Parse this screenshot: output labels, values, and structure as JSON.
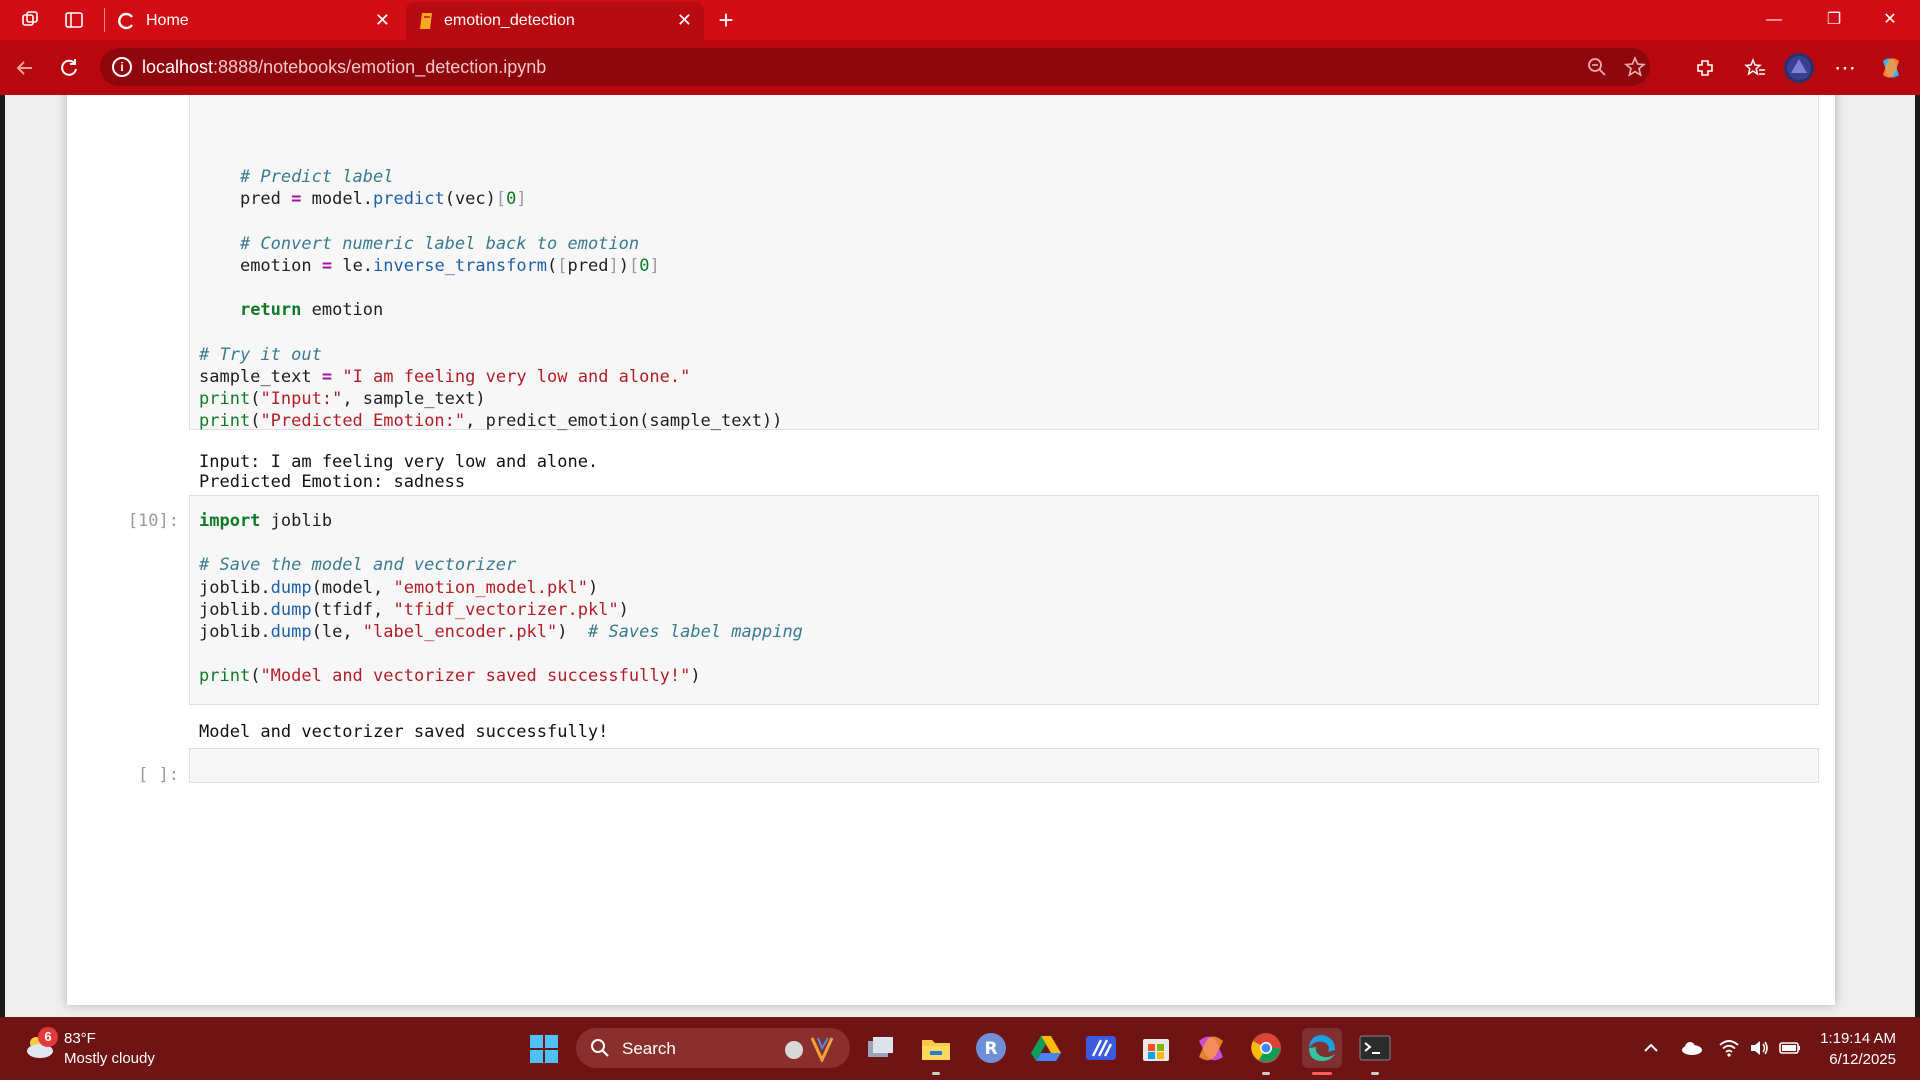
{
  "browser": {
    "tabs": [
      {
        "title": "Home",
        "close": "✕"
      },
      {
        "title": "emotion_detection",
        "close": "✕"
      }
    ],
    "new_tab": "+",
    "window_controls": {
      "minimize": "—",
      "restore": "❐",
      "close": "✕"
    },
    "address": {
      "host": "localhost",
      "rest": ":8888/notebooks/emotion_detection.ipynb"
    }
  },
  "notebook": {
    "prev_cell_lines": [
      {
        "indent": "    ",
        "tokens": [
          {
            "t": "# Predict label",
            "c": "cm"
          }
        ]
      },
      {
        "indent": "    ",
        "tokens": [
          {
            "t": "pred ",
            "c": ""
          },
          {
            "t": "=",
            "c": "op"
          },
          {
            "t": " model.",
            "c": ""
          },
          {
            "t": "predict",
            "c": "fn"
          },
          {
            "t": "(vec)",
            "c": ""
          },
          {
            "t": "[",
            "c": "br"
          },
          {
            "t": "0",
            "c": "num"
          },
          {
            "t": "]",
            "c": "br"
          }
        ]
      },
      {
        "indent": "",
        "tokens": []
      },
      {
        "indent": "    ",
        "tokens": [
          {
            "t": "# Convert numeric label back to emotion",
            "c": "cm"
          }
        ]
      },
      {
        "indent": "    ",
        "tokens": [
          {
            "t": "emotion ",
            "c": ""
          },
          {
            "t": "=",
            "c": "op"
          },
          {
            "t": " le.",
            "c": ""
          },
          {
            "t": "inverse_transform",
            "c": "fn"
          },
          {
            "t": "(",
            "c": ""
          },
          {
            "t": "[",
            "c": "br"
          },
          {
            "t": "pred",
            "c": ""
          },
          {
            "t": "]",
            "c": "br"
          },
          {
            "t": ")",
            "c": ""
          },
          {
            "t": "[",
            "c": "br"
          },
          {
            "t": "0",
            "c": "num"
          },
          {
            "t": "]",
            "c": "br"
          }
        ]
      },
      {
        "indent": "",
        "tokens": []
      },
      {
        "indent": "    ",
        "tokens": [
          {
            "t": "return",
            "c": "kw"
          },
          {
            "t": " emotion",
            "c": ""
          }
        ]
      },
      {
        "indent": "",
        "tokens": []
      },
      {
        "indent": "",
        "tokens": [
          {
            "t": "# Try it out",
            "c": "cm"
          }
        ]
      },
      {
        "indent": "",
        "tokens": [
          {
            "t": "sample_text ",
            "c": ""
          },
          {
            "t": "=",
            "c": "op"
          },
          {
            "t": " ",
            "c": ""
          },
          {
            "t": "\"I am feeling very low and alone.\"",
            "c": "st"
          }
        ]
      },
      {
        "indent": "",
        "tokens": [
          {
            "t": "print",
            "c": "nb"
          },
          {
            "t": "(",
            "c": ""
          },
          {
            "t": "\"Input:\"",
            "c": "st"
          },
          {
            "t": ", sample_text)",
            "c": ""
          }
        ]
      },
      {
        "indent": "",
        "tokens": [
          {
            "t": "print",
            "c": "nb"
          },
          {
            "t": "(",
            "c": ""
          },
          {
            "t": "\"Predicted Emotion:\"",
            "c": "st"
          },
          {
            "t": ", predict_emotion(sample_text))",
            "c": ""
          }
        ]
      }
    ],
    "prev_output": [
      "Input: I am feeling very low and alone.",
      "Predicted Emotion: sadness"
    ],
    "cell10_prompt": "[10]:",
    "cell10_lines": [
      {
        "indent": "",
        "tokens": [
          {
            "t": "import",
            "c": "kw"
          },
          {
            "t": " joblib",
            "c": ""
          }
        ]
      },
      {
        "indent": "",
        "tokens": []
      },
      {
        "indent": "",
        "tokens": [
          {
            "t": "# Save the model and vectorizer",
            "c": "cm"
          }
        ]
      },
      {
        "indent": "",
        "tokens": [
          {
            "t": "joblib.",
            "c": ""
          },
          {
            "t": "dump",
            "c": "fn"
          },
          {
            "t": "(model, ",
            "c": ""
          },
          {
            "t": "\"emotion_model.pkl\"",
            "c": "st"
          },
          {
            "t": ")",
            "c": ""
          }
        ]
      },
      {
        "indent": "",
        "tokens": [
          {
            "t": "joblib.",
            "c": ""
          },
          {
            "t": "dump",
            "c": "fn"
          },
          {
            "t": "(tfidf, ",
            "c": ""
          },
          {
            "t": "\"tfidf_vectorizer.pkl\"",
            "c": "st"
          },
          {
            "t": ")",
            "c": ""
          }
        ]
      },
      {
        "indent": "",
        "tokens": [
          {
            "t": "joblib.",
            "c": ""
          },
          {
            "t": "dump",
            "c": "fn"
          },
          {
            "t": "(le, ",
            "c": ""
          },
          {
            "t": "\"label_encoder.pkl\"",
            "c": "st"
          },
          {
            "t": ")  ",
            "c": ""
          },
          {
            "t": "# Saves label mapping",
            "c": "cm"
          }
        ]
      },
      {
        "indent": "",
        "tokens": []
      },
      {
        "indent": "",
        "tokens": [
          {
            "t": "print",
            "c": "nb"
          },
          {
            "t": "(",
            "c": ""
          },
          {
            "t": "\"Model and vectorizer saved successfully!\"",
            "c": "st"
          },
          {
            "t": ")",
            "c": ""
          }
        ]
      }
    ],
    "cell10_output": "Model and vectorizer saved successfully!",
    "empty_prompt": "[ ]:"
  },
  "taskbar": {
    "weather": {
      "badge": "6",
      "temp": "83°F",
      "desc": "Mostly cloudy"
    },
    "search_label": "Search",
    "clock": {
      "time": "1:19:14 AM",
      "date": "6/12/2025"
    }
  },
  "colors": {
    "browser_red": "#d10c14",
    "taskbar": "#6e1414"
  }
}
